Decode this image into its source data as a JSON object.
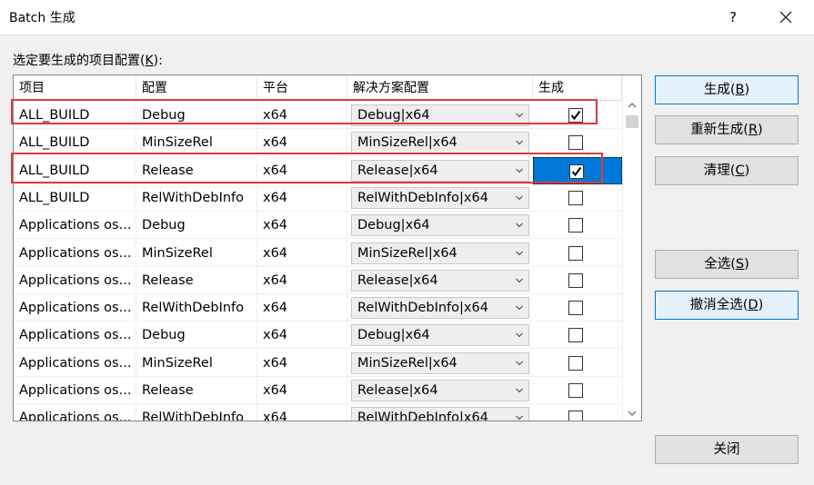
{
  "window": {
    "title": "Batch 生成",
    "help": "?"
  },
  "prompt": {
    "prefix": "选定要生成的项目配置(",
    "mnemonic": "K",
    "suffix": "):"
  },
  "columns": [
    "项目",
    "配置",
    "平台",
    "解决方案配置",
    "生成"
  ],
  "rows": [
    {
      "project": "ALL_BUILD",
      "config": "Debug",
      "platform": "x64",
      "solution": "Debug|x64",
      "build": true
    },
    {
      "project": "ALL_BUILD",
      "config": "MinSizeRel",
      "platform": "x64",
      "solution": "MinSizeRel|x64",
      "build": false
    },
    {
      "project": "ALL_BUILD",
      "config": "Release",
      "platform": "x64",
      "solution": "Release|x64",
      "build": true,
      "selected": true
    },
    {
      "project": "ALL_BUILD",
      "config": "RelWithDebInfo",
      "platform": "x64",
      "solution": "RelWithDebInfo|x64",
      "build": false
    },
    {
      "project": "Applications os...",
      "config": "Debug",
      "platform": "x64",
      "solution": "Debug|x64",
      "build": false
    },
    {
      "project": "Applications os...",
      "config": "MinSizeRel",
      "platform": "x64",
      "solution": "MinSizeRel|x64",
      "build": false
    },
    {
      "project": "Applications os...",
      "config": "Release",
      "platform": "x64",
      "solution": "Release|x64",
      "build": false
    },
    {
      "project": "Applications os...",
      "config": "RelWithDebInfo",
      "platform": "x64",
      "solution": "RelWithDebInfo|x64",
      "build": false
    },
    {
      "project": "Applications os...",
      "config": "Debug",
      "platform": "x64",
      "solution": "Debug|x64",
      "build": false
    },
    {
      "project": "Applications os...",
      "config": "MinSizeRel",
      "platform": "x64",
      "solution": "MinSizeRel|x64",
      "build": false
    },
    {
      "project": "Applications os...",
      "config": "Release",
      "platform": "x64",
      "solution": "Release|x64",
      "build": false
    },
    {
      "project": "Applications os...",
      "config": "RelWithDebInfo",
      "platform": "x64",
      "solution": "RelWithDebInfo|x64",
      "build": false
    }
  ],
  "buttons": {
    "build": {
      "label": "生成(",
      "mnemonic": "B",
      "end": ")"
    },
    "rebuild": {
      "label": "重新生成(",
      "mnemonic": "R",
      "end": ")"
    },
    "clean": {
      "label": "清理(",
      "mnemonic": "C",
      "end": ")"
    },
    "select_all": {
      "label": "全选(",
      "mnemonic": "S",
      "end": ")"
    },
    "deselect_all": {
      "label": "撤消全选(",
      "mnemonic": "D",
      "end": ")"
    },
    "close": {
      "label": "关闭"
    }
  },
  "colors": {
    "selection": "#0078d7",
    "highlight_box": "#e03a3a"
  }
}
